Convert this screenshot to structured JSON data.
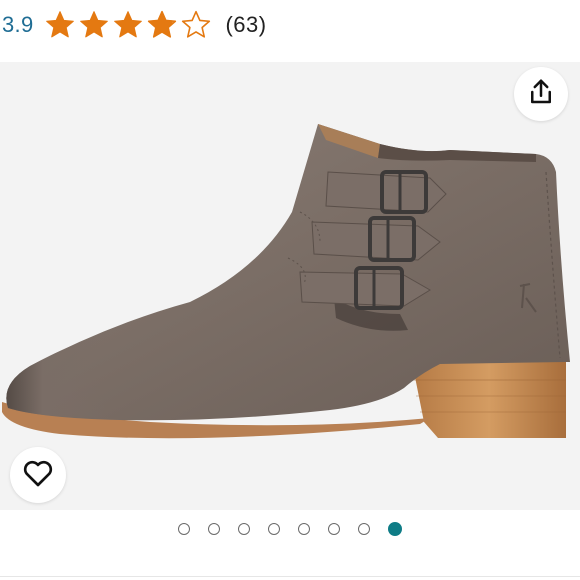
{
  "rating": {
    "value": "3.9",
    "stars_filled": 3.9,
    "stars_total": 5,
    "count": "(63)",
    "star_color": "#e47911"
  },
  "product": {
    "image_icon": "ankle-boot-image",
    "share_icon": "share-icon",
    "wishlist_icon": "heart-icon"
  },
  "pager": {
    "total": 8,
    "active_index": 7,
    "active_color": "#0e7c86"
  }
}
